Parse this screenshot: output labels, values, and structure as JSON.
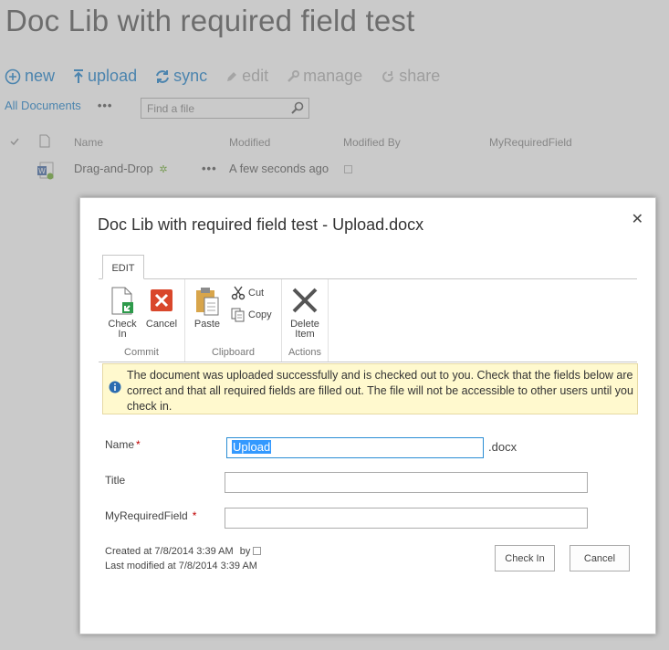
{
  "page": {
    "title": "Doc Lib with required field test"
  },
  "commands": [
    {
      "label": "new",
      "icon": "plus-circle-icon",
      "enabled": true
    },
    {
      "label": "upload",
      "icon": "upload-arrow-icon",
      "enabled": true
    },
    {
      "label": "sync",
      "icon": "sync-icon",
      "enabled": true
    },
    {
      "label": "edit",
      "icon": "pencil-icon",
      "enabled": false
    },
    {
      "label": "manage",
      "icon": "wrench-icon",
      "enabled": false
    },
    {
      "label": "share",
      "icon": "share-icon",
      "enabled": false
    }
  ],
  "views": {
    "current": "All Documents",
    "more": "•••"
  },
  "search": {
    "placeholder": "Find a file"
  },
  "list": {
    "columns": [
      "Name",
      "Modified",
      "Modified By",
      "MyRequiredField"
    ],
    "rows": [
      {
        "name": "Drag-and-Drop",
        "new_marker": "✲",
        "actions": "•••",
        "modified": "A few seconds ago"
      }
    ]
  },
  "dialog": {
    "title": "Doc Lib with required field test - Upload.docx",
    "close_label": "✕",
    "ribbon": {
      "tab": "EDIT",
      "groups": {
        "commit": {
          "label": "Commit",
          "check_in": "Check\nIn",
          "check_in_1": "Check",
          "check_in_2": "In",
          "cancel": "Cancel"
        },
        "clipboard": {
          "label": "Clipboard",
          "paste": "Paste",
          "cut": "Cut",
          "copy": "Copy"
        },
        "actions": {
          "label": "Actions",
          "delete_1": "Delete",
          "delete_2": "Item"
        }
      }
    },
    "notice": "The document was uploaded successfully and is checked out to you. Check that the fields below are correct and that all required fields are filled out. The file will not be accessible to other users until you check in.",
    "fields": {
      "name": {
        "label": "Name",
        "required": "*",
        "value": "Upload",
        "extension": ".docx"
      },
      "title": {
        "label": "Title",
        "value": ""
      },
      "my_required_field": {
        "label": "MyRequiredField",
        "required": "*",
        "value": ""
      }
    },
    "meta": {
      "created": "Created at 7/8/2014 3:39 AM",
      "by": "by",
      "modified": "Last modified at 7/8/2014 3:39 AM"
    },
    "buttons": {
      "check_in": "Check In",
      "cancel": "Cancel"
    }
  },
  "colors": {
    "accent": "#0072c6",
    "notice_bg": "#fff9ce",
    "selection": "#3399ff"
  }
}
